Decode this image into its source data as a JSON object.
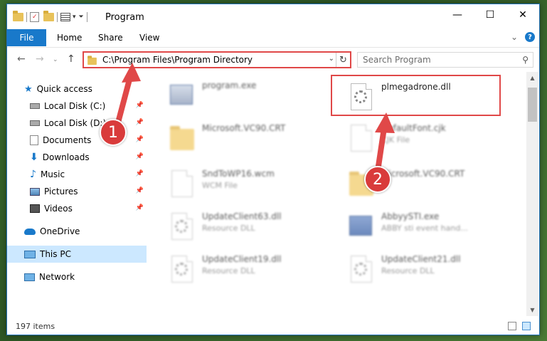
{
  "window": {
    "title": "Program",
    "controls": {
      "minimize": "—",
      "maximize": "☐",
      "close": "✕"
    }
  },
  "ribbon": {
    "tabs": [
      "File",
      "Home",
      "Share",
      "View"
    ],
    "collapse_glyph": "⌄",
    "help_glyph": "?"
  },
  "address": {
    "path": "C:\\Program Files\\Program Directory",
    "dropdown_glyph": "⌄",
    "refresh_glyph": "↻"
  },
  "search": {
    "placeholder": "Search Program"
  },
  "nav_buttons": {
    "back": "←",
    "forward": "→",
    "recent": "⌄",
    "up": "↑"
  },
  "navpane": {
    "items": [
      {
        "label": "Quick access",
        "icon": "star-icon",
        "pinned": false
      },
      {
        "label": "Local Disk (C:)",
        "icon": "drive-icon",
        "pinned": true
      },
      {
        "label": "Local Disk (D:)",
        "icon": "drive-icon",
        "pinned": true
      },
      {
        "label": "Documents",
        "icon": "documents-icon",
        "pinned": true
      },
      {
        "label": "Downloads",
        "icon": "downloads-icon",
        "pinned": true
      },
      {
        "label": "Music",
        "icon": "music-icon",
        "pinned": true
      },
      {
        "label": "Pictures",
        "icon": "pictures-icon",
        "pinned": true
      },
      {
        "label": "Videos",
        "icon": "videos-icon",
        "pinned": true
      },
      {
        "label": "OneDrive",
        "icon": "onedrive-icon",
        "pinned": false
      },
      {
        "label": "This PC",
        "icon": "computer-icon",
        "pinned": false,
        "selected": true
      },
      {
        "label": "Network",
        "icon": "network-icon",
        "pinned": false
      }
    ]
  },
  "files": [
    {
      "name": "program.exe",
      "type": "",
      "icon": "exe-icon"
    },
    {
      "name": "plmegadrone.dll",
      "type": "",
      "icon": "dll-gear-icon",
      "highlighted": true
    },
    {
      "name": "Microsoft.VC90.CRT",
      "type": "",
      "icon": "folder-icon"
    },
    {
      "name": "DefaultFont.cjk",
      "type": "CJK File",
      "icon": "file-icon"
    },
    {
      "name": "SndToWP16.wcm",
      "type": "WCM File",
      "icon": "file-icon"
    },
    {
      "name": "Microsoft.VC90.CRT",
      "type": "",
      "icon": "folder-icon"
    },
    {
      "name": "UpdateClient63.dll",
      "type": "Resource DLL",
      "icon": "dll-gear-icon"
    },
    {
      "name": "AbbyySTI.exe",
      "type": "ABBY sti event hand...",
      "icon": "exe-icon"
    },
    {
      "name": "UpdateClient19.dll",
      "type": "Resource DLL",
      "icon": "dll-gear-icon"
    },
    {
      "name": "UpdateClient21.dll",
      "type": "Resource DLL",
      "icon": "dll-gear-icon"
    }
  ],
  "status": {
    "count": "197 items"
  },
  "callouts": {
    "one": "1",
    "two": "2"
  },
  "colors": {
    "accent": "#1979ca",
    "highlight": "#e04848",
    "selected": "#cce8ff"
  }
}
